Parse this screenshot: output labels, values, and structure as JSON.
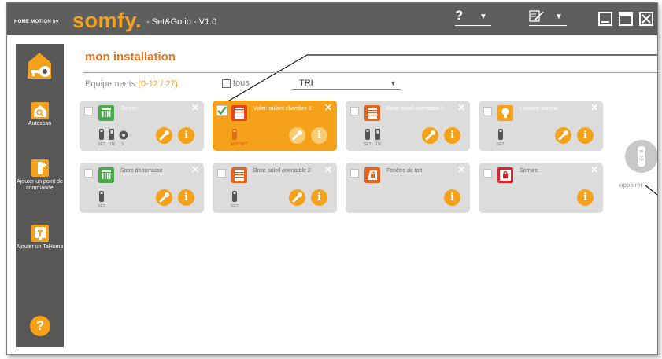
{
  "window": {
    "brand_prefix": "HOME MOTION by",
    "brand": "somfy.",
    "app_title": "- Set&Go io - V1.0",
    "help_label": "?",
    "caret": "▼"
  },
  "sidebar": {
    "autoscan_label": "Autoscan",
    "add_control_label": "Ajouter un point de commande",
    "add_tahoma_label": "Ajouter un TaHoma",
    "help_label": "?"
  },
  "main": {
    "title": "mon installation",
    "equipment_label": "Equipements",
    "equipment_count": "(0-12 / 27)",
    "all_label": "tous",
    "sort_label": "TRI"
  },
  "cards": [
    {
      "name": "Screen",
      "selected": false,
      "icon": "screen-icon",
      "color": "#4aa94a",
      "labels": [
        "SET",
        "1W",
        "3"
      ]
    },
    {
      "name": "Volet roulant chambre 1",
      "selected": true,
      "icon": "roller-shutter-icon",
      "color": "#e8431a",
      "labels": [
        "NOT SET"
      ]
    },
    {
      "name": "Brise-soleil orientable 1",
      "selected": false,
      "icon": "sun-blind-icon",
      "color": "#e8631a",
      "labels": [
        "SET",
        "1W"
      ]
    },
    {
      "name": "Lumière cuisine",
      "selected": false,
      "icon": "light-icon",
      "color": "#f5a21a",
      "labels": [
        "SET"
      ]
    },
    {
      "name": "Store de terrasse",
      "selected": false,
      "icon": "awning-icon",
      "color": "#4aa94a",
      "labels": [
        "SET"
      ]
    },
    {
      "name": "Brise-soleil orientable 2",
      "selected": false,
      "icon": "sun-blind-icon",
      "color": "#e8631a",
      "labels": [
        "SET"
      ]
    },
    {
      "name": "Fenêtre de toit",
      "selected": false,
      "icon": "roof-window-icon",
      "color": "#e8631a",
      "labels": []
    },
    {
      "name": "Serrure",
      "selected": false,
      "icon": "lock-icon",
      "color": "#d8262a",
      "labels": []
    }
  ],
  "pairing": {
    "label": "appairer"
  }
}
